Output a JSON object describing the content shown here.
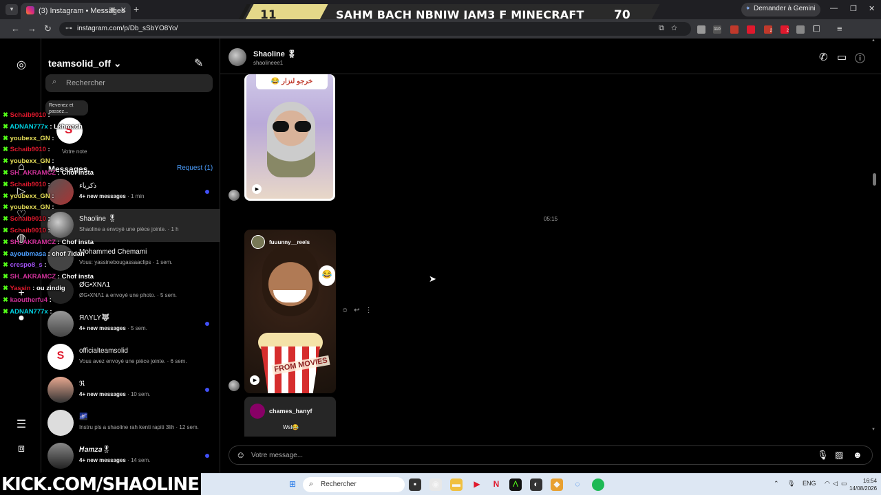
{
  "browser": {
    "tab_title": "(3) Instagram • Messages",
    "url": "instagram.com/p/Db_sSbYO8Yo/",
    "gemini_label": "Demander à Gemini",
    "ext_badges": [
      "110",
      "2",
      "2"
    ],
    "profile_initial": "M"
  },
  "stream_banner": {
    "left_number": "11",
    "title": "SAHM BACH NBNIW JAM3 F MINECRAFT",
    "right_number": "70"
  },
  "inbox": {
    "username": "teamsolid_off",
    "search_placeholder": "Rechercher",
    "note_text": "Revenez et passez...",
    "your_note_label": "Votre note",
    "messages_title": "Messages",
    "request_label": "Request (1)",
    "conversations": [
      {
        "name": "ذكرياء",
        "subtitle": "4+ new messages",
        "time": " · 1 min",
        "unread": true,
        "bold": true
      },
      {
        "name": "Shaoline 🎖",
        "subtitle": "Shaoline a envoyé une pièce jointe.",
        "time": " · 1 h",
        "unread": false,
        "bold": false,
        "active": true
      },
      {
        "name": "Mohammed Chemami",
        "subtitle": "Vous: yassinebougassaaclips",
        "time": " · 1 sem.",
        "unread": false,
        "bold": false
      },
      {
        "name": "ØG•XNΛ1",
        "subtitle": "ØG•XNΛ1 a envoyé une photo.",
        "time": " · 5 sem.",
        "unread": false,
        "bold": false
      },
      {
        "name": "ЯΛYLY🐺",
        "subtitle": "4+ new messages",
        "time": " · 5 sem.",
        "unread": true,
        "bold": true
      },
      {
        "name": "officialteamsolid",
        "subtitle": "Vous avez envoyé une pièce jointe.",
        "time": " · 6 sem.",
        "unread": false,
        "bold": false
      },
      {
        "name": "ℜ",
        "subtitle": "4+ new messages",
        "time": " · 10 sem.",
        "unread": true,
        "bold": true
      },
      {
        "name": "🌌",
        "subtitle": "Instru pls a shaoline rah kenti rapiti 3lih",
        "time": " · 12 sem.",
        "unread": false,
        "bold": false
      },
      {
        "name": "𝑯𝒂𝒎𝒛𝒂🎖",
        "subtitle": "4+ new messages",
        "time": " · 14 sem.",
        "unread": true,
        "bold": true
      }
    ]
  },
  "chat": {
    "contact_name": "Shaoline 🎖",
    "contact_handle": "shaolineee1",
    "media1_caption": "😂 خرجو لنزار",
    "timestamp": "05:15",
    "reel_author": "fuuunny__reels",
    "movies_label": "FROM MOVIES",
    "share_author": "chames_hanyf",
    "share_caption": "Wsl😂",
    "composer_placeholder": "Votre message..."
  },
  "stream_chat": [
    {
      "user": "Schaib9010",
      "color": "#e0192d",
      "text": ""
    },
    {
      "user": "ADNAN777x",
      "color": "#00d0e0",
      "text": "Lkhmach"
    },
    {
      "user": "youbexx_GN",
      "color": "#e8e05a",
      "text": ""
    },
    {
      "user": "Schaib9010",
      "color": "#e0192d",
      "text": ""
    },
    {
      "user": "youbexx_GN",
      "color": "#e8e05a",
      "text": ""
    },
    {
      "user": "SH_AKRAMCZ",
      "color": "#d0329a",
      "text": "Chof insta"
    },
    {
      "user": "Schaib9010",
      "color": "#e0192d",
      "text": ""
    },
    {
      "user": "youbexx_GN",
      "color": "#e8e05a",
      "text": ""
    },
    {
      "user": "youbexx_GN",
      "color": "#e8e05a",
      "text": ""
    },
    {
      "user": "Schaib9010",
      "color": "#e0192d",
      "text": ""
    },
    {
      "user": "Schaib9010",
      "color": "#e0192d",
      "text": ""
    },
    {
      "user": "SH_AKRAMCZ",
      "color": "#d0329a",
      "text": "Chof insta"
    },
    {
      "user": "ayoubmasa",
      "color": "#4c9fff",
      "text": "chof 7idan"
    },
    {
      "user": "crespo8_s",
      "color": "#a050f0",
      "text": ""
    },
    {
      "user": "SH_AKRAMCZ",
      "color": "#d0329a",
      "text": "Chof insta"
    },
    {
      "user": "Yassin",
      "color": "#e0192d",
      "text": "ou zindig"
    },
    {
      "user": "kaoutherfu4",
      "color": "#d0329a",
      "text": ""
    },
    {
      "user": "ADNAN777x",
      "color": "#00d0e0",
      "text": ""
    }
  ],
  "kick_overlay": {
    "k": "K",
    "rest": "KICK.COM/SHAOLINE"
  },
  "taskbar": {
    "search_placeholder": "Rechercher",
    "lang": "ENG",
    "time": "16:54",
    "date": "14/08/2026"
  }
}
